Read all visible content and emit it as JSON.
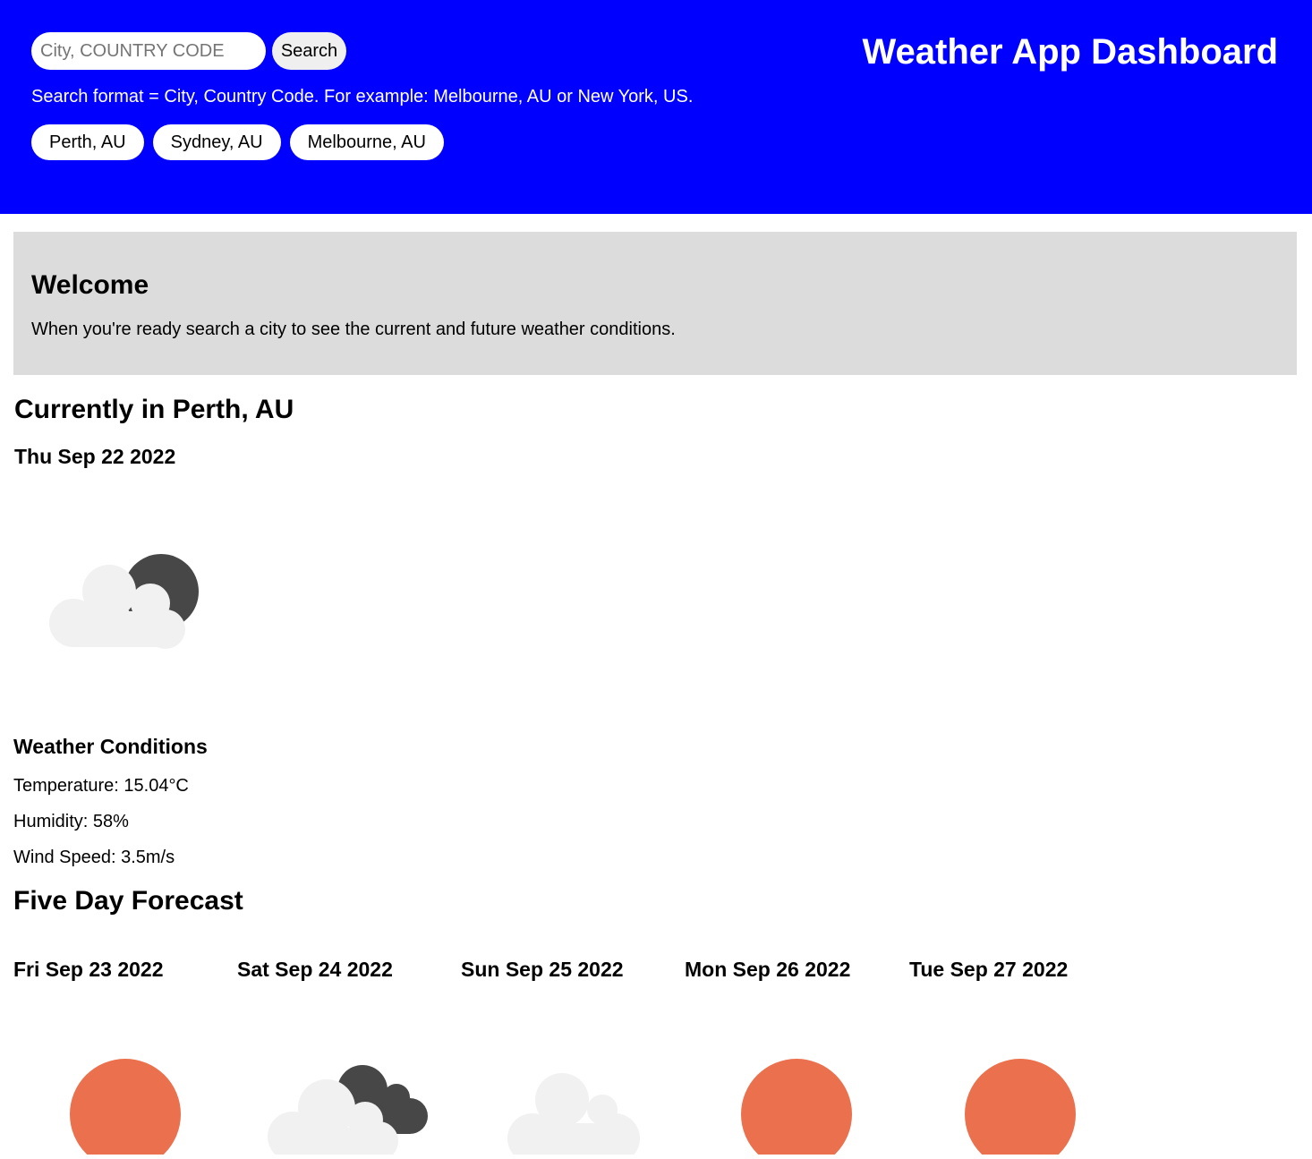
{
  "header": {
    "title": "Weather App Dashboard",
    "search_placeholder": "City, COUNTRY CODE",
    "search_value": "",
    "search_button": "Search",
    "hint": "Search format = City, Country Code. For example: Melbourne, AU or New York, US.",
    "history": [
      "Perth, AU",
      "Sydney, AU",
      "Melbourne, AU"
    ]
  },
  "welcome": {
    "title": "Welcome",
    "text": "When you're ready search a city to see the current and future weather conditions."
  },
  "current": {
    "title": "Currently in Perth, AU",
    "date": "Thu Sep 22 2022",
    "icon": "partly-cloudy-night-icon",
    "conditions_title": "Weather Conditions",
    "temperature": "Temperature: 15.04°C",
    "humidity": "Humidity: 58%",
    "wind": "Wind Speed: 3.5m/s"
  },
  "forecast": {
    "title": "Five Day Forecast",
    "days": [
      {
        "date": "Fri Sep 23 2022",
        "icon": "sun-icon"
      },
      {
        "date": "Sat Sep 24 2022",
        "icon": "cloudy-icon"
      },
      {
        "date": "Sun Sep 25 2022",
        "icon": "cloud-icon"
      },
      {
        "date": "Mon Sep 26 2022",
        "icon": "sun-icon"
      },
      {
        "date": "Tue Sep 27 2022",
        "icon": "sun-icon"
      }
    ]
  },
  "colors": {
    "header_bg": "#0000ff",
    "welcome_bg": "#dcdcdc",
    "sun": "#eb704d",
    "cloud_light": "#f1f1f1",
    "cloud_dark": "#474747"
  }
}
